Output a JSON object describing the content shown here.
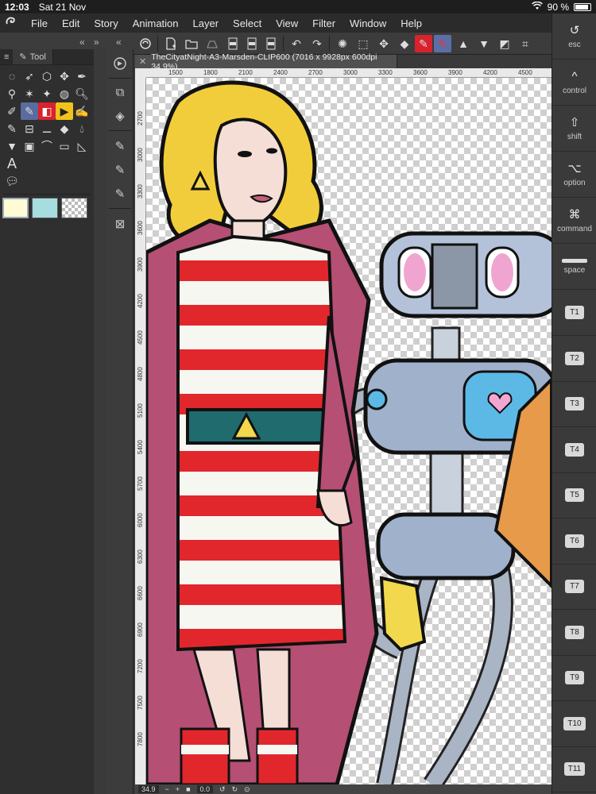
{
  "status_bar": {
    "time": "12:03",
    "date": "Sat 21 Nov",
    "battery": "90 %",
    "battery_level": 0.9
  },
  "menu": [
    "File",
    "Edit",
    "Story",
    "Animation",
    "Layer",
    "Select",
    "View",
    "Filter",
    "Window",
    "Help"
  ],
  "tool_panel": {
    "tab_label": "Tool",
    "swatches": [
      "#fffbd5",
      "#a6dde0",
      "transparent"
    ]
  },
  "document": {
    "tab_title": "TheCityatNight-A3-Marsden-CLIP600 (7016 x 9928px 600dpi 34.9%)"
  },
  "rulers": {
    "top_labels": [
      "1500",
      "1800",
      "2100",
      "2400",
      "2700",
      "3000",
      "3300",
      "3600",
      "3900",
      "4200",
      "4500"
    ],
    "left_labels": [
      "2700",
      "3000",
      "3300",
      "3600",
      "3900",
      "4200",
      "4500",
      "4800",
      "5100",
      "5400",
      "5700",
      "6000",
      "6300",
      "6600",
      "6900",
      "7200",
      "7500",
      "7800"
    ]
  },
  "bottom_bar": {
    "zoom": "34.9",
    "angle": "0.0"
  },
  "right_panel": {
    "keys": [
      {
        "glyph": "↺",
        "label": "esc"
      },
      {
        "glyph": "^",
        "label": "control"
      },
      {
        "glyph": "⇧",
        "label": "shift"
      },
      {
        "glyph": "⌥",
        "label": "option"
      },
      {
        "glyph": "⌘",
        "label": "command"
      },
      {
        "glyph": "",
        "label": "space"
      }
    ],
    "t_keys": [
      "T1",
      "T2",
      "T3",
      "T4",
      "T5",
      "T6",
      "T7",
      "T8",
      "T9",
      "T10",
      "T11"
    ]
  },
  "colors": {
    "menubar": "#2b2b2b",
    "panel": "#2f2f2f",
    "accent": "#5a6b9e"
  }
}
